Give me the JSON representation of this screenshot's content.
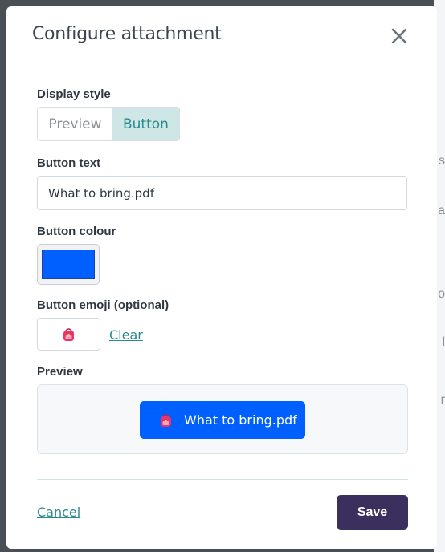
{
  "background": {
    "partial_chars": [
      "s",
      "a",
      "o",
      "l",
      "r"
    ]
  },
  "modal": {
    "title": "Configure attachment",
    "close_icon": "close-icon"
  },
  "display_style": {
    "label": "Display style",
    "options": [
      "Preview",
      "Button"
    ],
    "selected": "Button"
  },
  "button_text": {
    "label": "Button text",
    "value": "What to bring.pdf"
  },
  "button_colour": {
    "label": "Button colour",
    "value": "#0060ff"
  },
  "button_emoji": {
    "label": "Button emoji (optional)",
    "emoji": "🎒",
    "clear_label": "Clear"
  },
  "preview": {
    "label": "Preview",
    "button_text": "What to bring.pdf",
    "emoji": "🎒"
  },
  "footer": {
    "cancel_label": "Cancel",
    "save_label": "Save"
  },
  "colors": {
    "accent": "#2b8a8e",
    "selected_segment": "#cfe6e6",
    "save_button": "#3b2f5e",
    "preview_button": "#0060ff",
    "overlay": "#4a4f55"
  }
}
